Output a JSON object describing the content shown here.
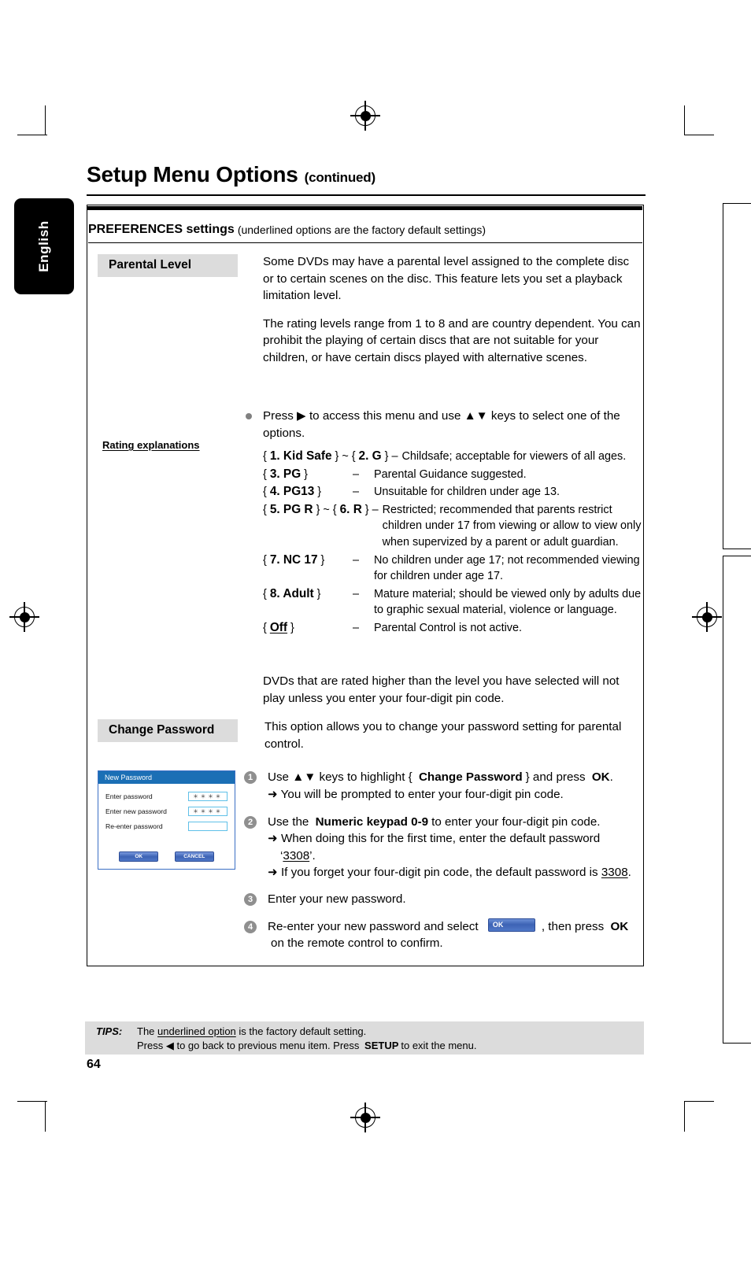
{
  "page": {
    "title": "Setup Menu Options",
    "title_suffix": "(continued)",
    "side_tab": "English",
    "page_number": "64"
  },
  "section_header": {
    "lead": "PREFERENCES settings",
    "note": "(underlined options are the factory default settings)"
  },
  "parental_level": {
    "chip_label": "Parental Level",
    "paragraph_1": "Some DVDs may have a parental level assigned to the complete disc or to certain scenes on the disc. This feature lets you set a playback limitation level.",
    "paragraph_2": "The rating levels range from 1 to 8 and are country dependent. You can prohibit the playing of certain discs that are not suitable for your children, or have certain discs played with alternative scenes.",
    "bullet": "Press ▶ to access this menu and use ▲▼ keys to select one of the options.",
    "left_note": "Rating explanations",
    "closing": "DVDs that are rated higher than the level you have selected will not play unless you enter your four-digit pin code."
  },
  "ratings": [
    {
      "key_open": "{",
      "key_bold": "1. Kid Safe",
      "key_mid": "} ~ {",
      "key_bold2": "2. G",
      "key_close": "}",
      "dash": "–",
      "desc": "Childsafe; acceptable for viewers of all ages."
    },
    {
      "key_open": "{",
      "key_bold": "3. PG",
      "key_close": "}",
      "dash": "–",
      "desc": "Parental Guidance suggested."
    },
    {
      "key_open": "{",
      "key_bold": "4. PG13",
      "key_close": "}",
      "dash": "–",
      "desc": "Unsuitable for children under age 13."
    },
    {
      "key_open": "{",
      "key_bold": "5. PG R",
      "key_mid": "} ~ {",
      "key_bold2": "6. R",
      "key_close": "}",
      "dash": "–",
      "desc": "Restricted; recommended that parents restrict children under 17 from viewing or allow to view only when supervized by a parent or adult guardian."
    },
    {
      "key_open": "{",
      "key_bold": "7. NC 17",
      "key_close": "}",
      "dash": "–",
      "desc": "No children under age 17; not recommended viewing for children under age 17."
    },
    {
      "key_open": "{",
      "key_bold": "8. Adult",
      "key_close": "}",
      "dash": "–",
      "desc": "Mature material; should be viewed only by adults due to graphic sexual material, violence or language."
    },
    {
      "key_open": "{",
      "key_bold": "Off",
      "key_underlined": true,
      "key_close": "}",
      "dash": "–",
      "desc": "Parental Control is not active."
    }
  ],
  "change_password": {
    "chip_label": "Change Password",
    "intro": "This option allows you to change your password setting for parental control."
  },
  "dialog": {
    "title": "New Password",
    "rows": [
      {
        "label": "Enter password",
        "value": "＊＊＊＊"
      },
      {
        "label": "Enter new password",
        "value": "＊＊＊＊"
      },
      {
        "label": "Re-enter password",
        "value": ""
      }
    ],
    "ok_label": "OK",
    "cancel_label": "CANCEL"
  },
  "steps": [
    {
      "num": "1",
      "pre": "Use ▲▼ keys to highlight {",
      "bold": "Change Password",
      "post": "} and press",
      "bold_end": "OK",
      "tail": ".",
      "subs": [
        "➜ You will be prompted to enter your four-digit pin code."
      ]
    },
    {
      "num": "2",
      "pre": "Use the",
      "bold": "Numeric keypad 0-9",
      "post": "to enter your four-digit pin code.",
      "subs": [
        "➜ When doing this for the first time, enter the default password ‘3308’.",
        "➜ If you forget your four-digit pin code, the default password is 3308."
      ],
      "sub_underlined": "3308"
    },
    {
      "num": "3",
      "pre": "Enter your new password.",
      "subs": []
    },
    {
      "num": "4",
      "pre": "Re-enter your new password and select",
      "widget": "ok-button",
      "post": ", then press",
      "bold_end": "OK",
      "tail": "on the remote control to confirm.",
      "subs": []
    }
  ],
  "tips": {
    "label": "TIPS:",
    "line1_pre": "The",
    "line1_underlined": "underlined option",
    "line1_post": "is the factory default setting.",
    "line2_pre": "Press ◀ to go back to previous menu item. Press",
    "line2_bold": "SETUP",
    "line2_post": "to exit the menu."
  },
  "colors": {
    "chip_bg": "#dcdcdc",
    "dialog_title_bg": "#1b6fb5",
    "dialog_border": "#3b6fc4",
    "input_border": "#5fc0e8",
    "step_num_bg": "#8f8f8f",
    "button_blue": "#3d63b5"
  }
}
